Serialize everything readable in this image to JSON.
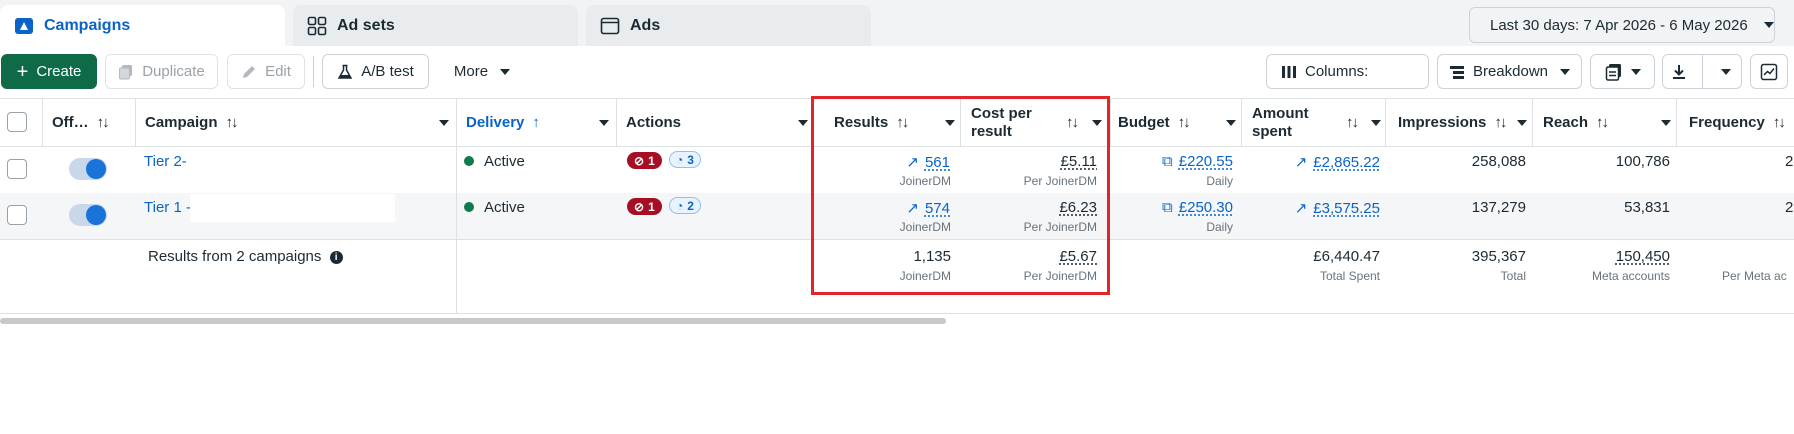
{
  "tabs": [
    {
      "label": "Campaigns",
      "icon": "campaign-folder-icon",
      "active": true
    },
    {
      "label": "Ad sets",
      "icon": "grid-icon",
      "active": false
    },
    {
      "label": "Ads",
      "icon": "ad-window-icon",
      "active": false
    }
  ],
  "date_range": {
    "label": "Last 30 days: 7 Apr 2026 - 6 May 2026",
    "icon": "calendar-icon"
  },
  "toolbar": {
    "create": "Create",
    "duplicate": "Duplicate",
    "edit": "Edit",
    "ab_test": "A/B test",
    "more": "More",
    "columns": "Columns:",
    "breakdown": "Breakdown"
  },
  "columns": {
    "off": "Off…",
    "campaign": "Campaign",
    "delivery": "Delivery",
    "actions": "Actions",
    "results": "Results",
    "cost_per_result_1": "Cost per",
    "cost_per_result_2": "result",
    "budget": "Budget",
    "amount_spent_1": "Amount",
    "amount_spent_2": "spent",
    "impressions": "Impressions",
    "reach": "Reach",
    "frequency": "Frequency"
  },
  "rows": [
    {
      "campaign": "Tier 2-",
      "delivery": "Active",
      "issues": "1",
      "recommendations": "3",
      "results": "561",
      "results_sub": "JoinerDM",
      "cost_per_result": "£5.11",
      "cost_sub": "Per JoinerDM",
      "budget": "£220.55",
      "budget_sub": "Daily",
      "amount_spent": "£2,865.22",
      "impressions": "258,088",
      "reach": "100,786",
      "frequency": "2"
    },
    {
      "campaign": "Tier 1 -",
      "delivery": "Active",
      "issues": "1",
      "recommendations": "2",
      "results": "574",
      "results_sub": "JoinerDM",
      "cost_per_result": "£6.23",
      "cost_sub": "Per JoinerDM",
      "budget": "£250.30",
      "budget_sub": "Daily",
      "amount_spent": "£3,575.25",
      "impressions": "137,279",
      "reach": "53,831",
      "frequency": "2"
    }
  ],
  "summary": {
    "label": "Results from 2 campaigns",
    "results": "1,135",
    "results_sub": "JoinerDM",
    "cost_per_result": "£5.67",
    "cost_sub": "Per JoinerDM",
    "amount_spent": "£6,440.47",
    "amount_sub": "Total Spent",
    "impressions": "395,367",
    "impressions_sub": "Total",
    "reach": "150,450",
    "reach_sub": "Meta accounts",
    "frequency_sub": "Per Meta ac"
  },
  "colors": {
    "accent": "#0a64c8",
    "create_green": "#0f6b47",
    "highlight_red": "#e0262b",
    "active_green": "#0f7a4d",
    "issue_red": "#a50e23"
  }
}
